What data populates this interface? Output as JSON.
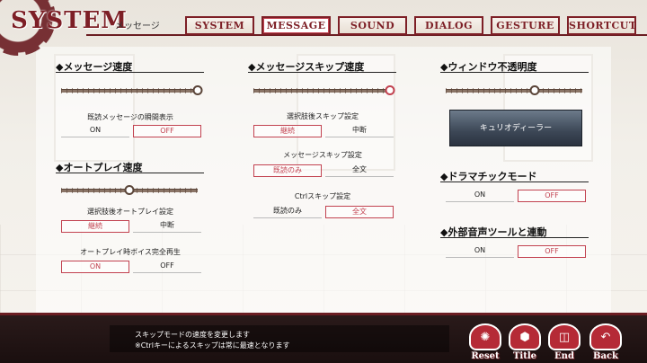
{
  "header": {
    "title": "SYSTEM",
    "subtitle": "メッセージ"
  },
  "tabs": [
    {
      "label": "SYSTEM",
      "active": false
    },
    {
      "label": "MESSAGE",
      "active": true
    },
    {
      "label": "SOUND",
      "active": false
    },
    {
      "label": "DIALOG",
      "active": false
    },
    {
      "label": "GESTURE",
      "active": false
    },
    {
      "label": "SHORTCUT",
      "active": false
    }
  ],
  "message_speed": {
    "title": "◆メッセージ速度",
    "level": 1.0,
    "instant_label": "既読メッセージの瞬間表示",
    "on": "ON",
    "off": "OFF",
    "selected": "OFF"
  },
  "auto_play": {
    "title": "◆オートプレイ速度",
    "level": 0.5,
    "after_choice_label": "選択肢後オートプレイ設定",
    "continue": "継続",
    "stop": "中断",
    "after_choice_selected": "継続",
    "voice_label": "オートプレイ時ボイス完全再生",
    "on": "ON",
    "off": "OFF",
    "voice_selected": "ON"
  },
  "skip_speed": {
    "title": "◆メッセージスキップ速度",
    "level": 1.0,
    "after_choice_label": "選択肢後スキップ設定",
    "continue": "継続",
    "stop": "中断",
    "after_choice_selected": "継続",
    "skip_label": "メッセージスキップ設定",
    "read_only": "既読のみ",
    "all": "全文",
    "skip_selected": "既読のみ",
    "ctrl_label": "Ctrlスキップ設定",
    "ctrl_selected": "全文"
  },
  "window_opacity": {
    "title": "◆ウィンドウ不透明度",
    "level": 0.65,
    "preview_text": "キュリオディーラー"
  },
  "dramatic": {
    "title": "◆ドラマチックモード",
    "on": "ON",
    "off": "OFF",
    "selected": "OFF"
  },
  "external_voice": {
    "title": "◆外部音声ツールと連動",
    "on": "ON",
    "off": "OFF",
    "selected": "OFF"
  },
  "footer": {
    "message_line1": "スキップモードの速度を変更します",
    "message_line2": "※Ctrlキーによるスキップは常に最速となります",
    "buttons": [
      {
        "label": "Reset",
        "icon": "reset-icon"
      },
      {
        "label": "Title",
        "icon": "title-icon"
      },
      {
        "label": "End",
        "icon": "door-icon"
      },
      {
        "label": "Back",
        "icon": "back-arrow-icon"
      }
    ]
  },
  "colors": {
    "accent": "#7d1f26",
    "selected": "#c24250",
    "footer": "#1a0f0f"
  }
}
